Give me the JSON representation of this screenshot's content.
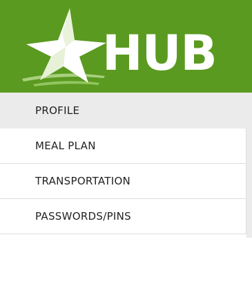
{
  "header": {
    "logo_text": "HUB",
    "logo_icon": "star-icon",
    "background_color": "#5b9a20"
  },
  "nav": {
    "items": [
      {
        "label": "PROFILE",
        "active": true
      },
      {
        "label": "MEAL PLAN",
        "active": false
      },
      {
        "label": "TRANSPORTATION",
        "active": false
      },
      {
        "label": "PASSWORDS/PINS",
        "active": false
      }
    ]
  }
}
